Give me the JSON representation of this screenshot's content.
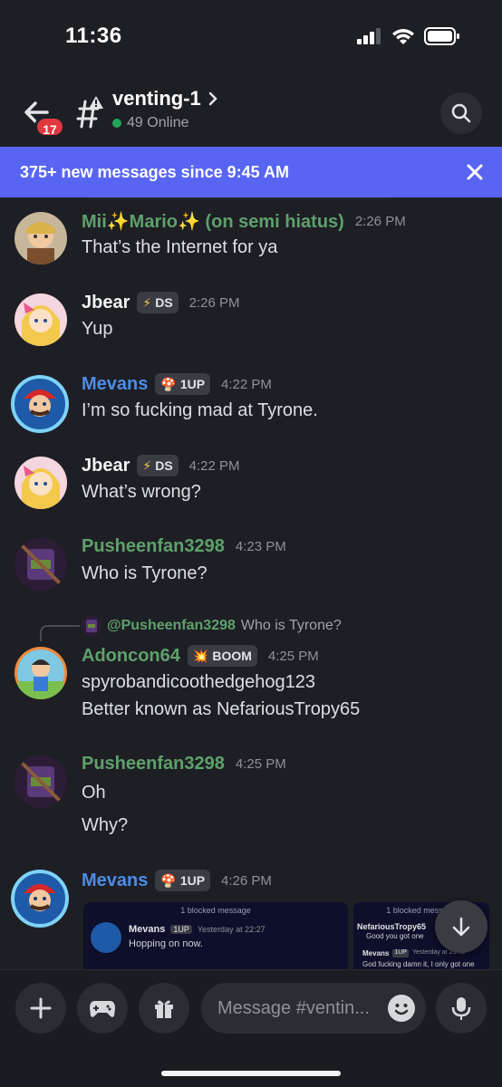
{
  "status": {
    "time": "11:36"
  },
  "header": {
    "back_badge": "17",
    "channel_name": "venting-1",
    "online": "49 Online"
  },
  "banner": {
    "text": "375+ new messages since 9:45 AM"
  },
  "messages": [
    {
      "name": "Mii✨Mario✨ (on semi hiatus)",
      "time": "2:26 PM",
      "lines": [
        "That’s the Internet for ya"
      ]
    },
    {
      "name": "Jbear",
      "tag": "DS",
      "time": "2:26 PM",
      "lines": [
        "Yup"
      ]
    },
    {
      "name": "Mevans",
      "tag": "1UP",
      "time": "4:22 PM",
      "lines": [
        "I’m so fucking mad at Tyrone."
      ]
    },
    {
      "name": "Jbear",
      "tag": "DS",
      "time": "4:22 PM",
      "lines": [
        "What’s wrong?"
      ]
    },
    {
      "name": "Pusheenfan3298",
      "time": "4:23 PM",
      "lines": [
        "Who is Tyrone?"
      ]
    },
    {
      "reply_to": "@Pusheenfan3298",
      "reply_text": "Who is Tyrone?",
      "name": "Adoncon64",
      "tag": "BOOM",
      "time": "4:25 PM",
      "lines": [
        "spyrobandicoothedgehog123",
        "Better known as NefariousTropy65"
      ]
    },
    {
      "name": "Pusheenfan3298",
      "time": "4:25 PM",
      "lines": [
        "Oh",
        "Why?"
      ]
    },
    {
      "name": "Mevans",
      "tag": "1UP",
      "time": "4:26 PM",
      "lines": []
    }
  ],
  "embeds": [
    {
      "header": "1 blocked message",
      "name": "Mevans",
      "tag": "1UP",
      "time": "Yesterday at 22:27",
      "text": "Hopping on now."
    },
    {
      "header": "1 blocked message",
      "name": "NefariousTropy65",
      "text": "Good you got one",
      "name2": "Mevans",
      "tag2": "1UP",
      "time2": "Yesterday at 23:43",
      "text2": "God fucking damn it, I only got one"
    }
  ],
  "composer": {
    "placeholder": "Message #ventin..."
  },
  "colors": {
    "accent": "#5865f2",
    "online": "#23a55a",
    "badge": "#e0383e",
    "green_name": "#5ea16b",
    "blue_name": "#4d8ce6"
  }
}
